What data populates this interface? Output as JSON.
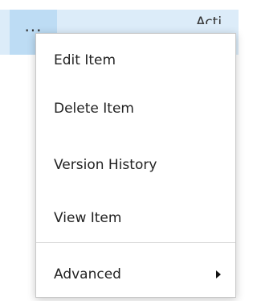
{
  "list_row": {
    "ellipsis": "...",
    "truncated_text": "Acti"
  },
  "context_menu": {
    "items": [
      {
        "label": "Edit Item"
      },
      {
        "label": "Delete Item"
      },
      {
        "label": "Version History"
      },
      {
        "label": "View Item"
      },
      {
        "label": "Advanced",
        "icon": "chevron-right-icon"
      }
    ]
  }
}
